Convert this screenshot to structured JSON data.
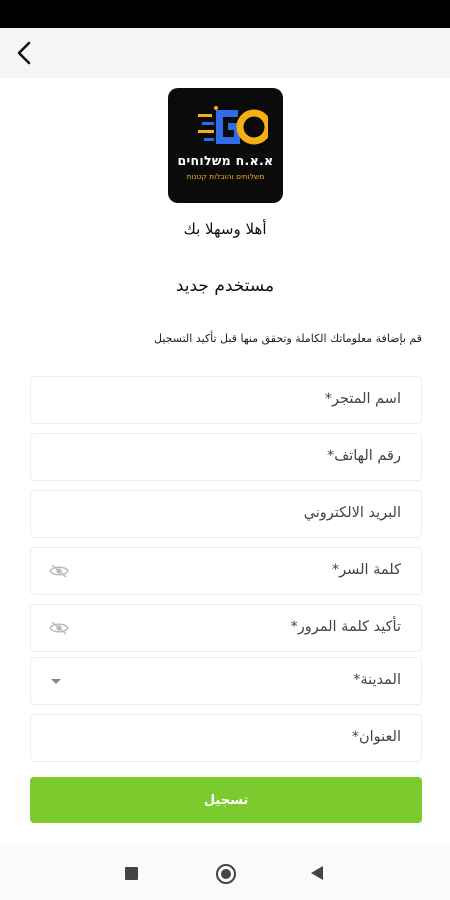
{
  "logo": {
    "letters": "GO",
    "title": "א.א.ח משלוחים",
    "subtitle": "משלוחים והובלות קטנות"
  },
  "welcome": "أهلا وسهلا بك",
  "heading": "مستخدم جديد",
  "instructions": "قم بإضافة معلوماتك الكاملة وتحقق منها قبل تأكيد التسجيل",
  "form": {
    "store_name": "اسم المتجر*",
    "phone": "رقم الهاتف*",
    "email": "البريد الالكتروني",
    "password": "كلمة السر*",
    "confirm_password": "تأكيد كلمة المرور*",
    "city": "المدينة*",
    "address": "العنوان*"
  },
  "submit_label": "تسجيل",
  "colors": {
    "accent": "#7ccb2e",
    "logo_blue": "#2f6de8",
    "logo_orange": "#f5b114"
  },
  "icons": {
    "back": "arrow-back-icon",
    "password_toggle": "eye-off-icon",
    "dropdown": "chevron-down-icon"
  }
}
